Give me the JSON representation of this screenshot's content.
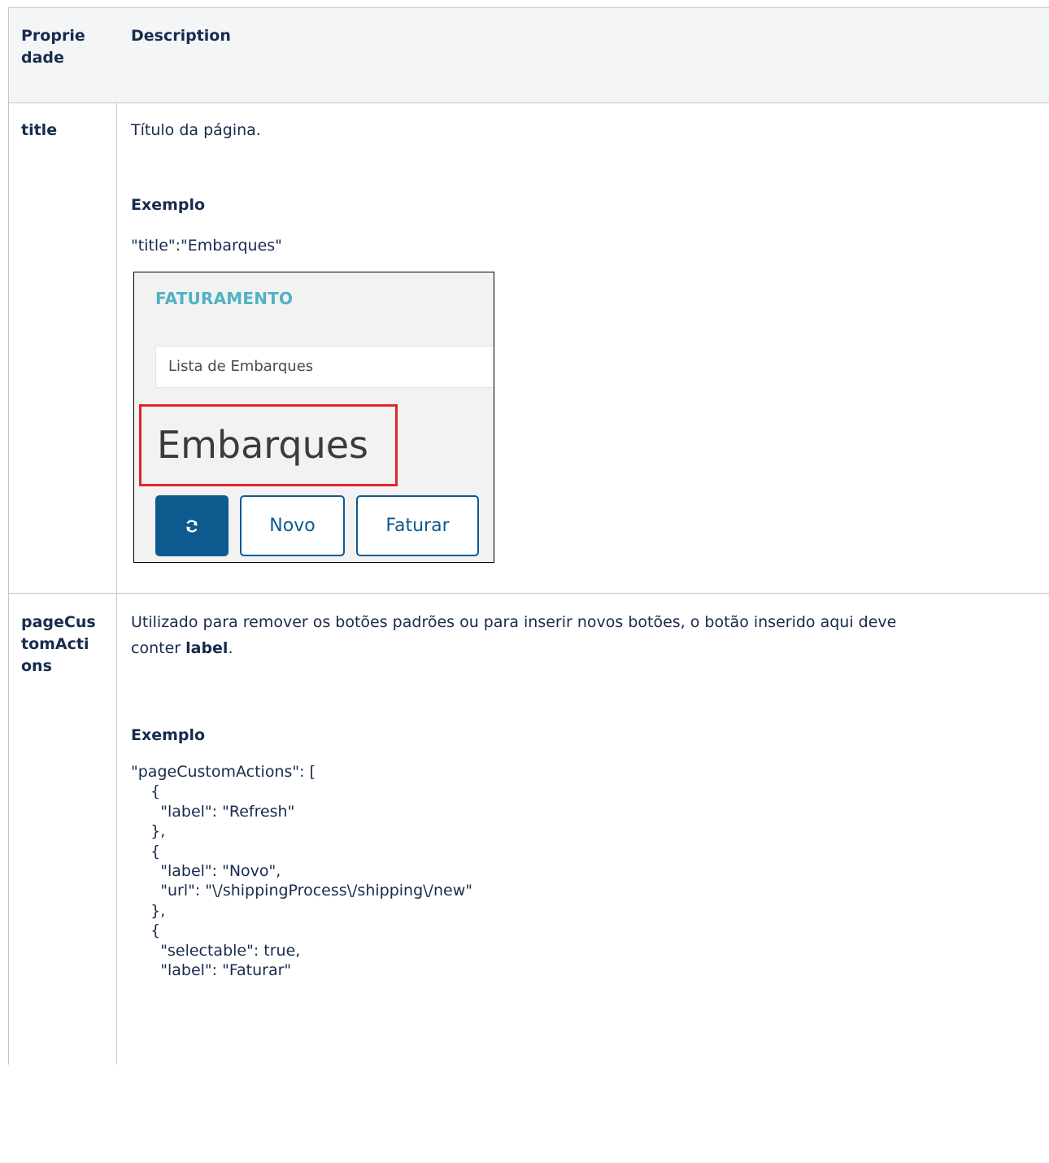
{
  "table": {
    "headers": {
      "property": "Proprie\ndade",
      "description": "Description"
    },
    "rows": [
      {
        "property": "title",
        "description": "Título da página.",
        "example_heading": "Exemplo",
        "example_code": "\"title\":\"Embarques\"",
        "screenshot": {
          "section_title": "FATURAMENTO",
          "breadcrumb": "Lista de Embarques",
          "page_title": "Embarques",
          "buttons": {
            "refresh_icon": "refresh-icon",
            "novo": "Novo",
            "faturar": "Faturar"
          },
          "colors": {
            "title": "#4fb3c1",
            "primary": "#0d5a8f",
            "highlight": "#e0242c"
          }
        }
      },
      {
        "property": "pageCus\ntomActi\nons",
        "description_part1": "Utilizado para remover os botões padrões ou para inserir novos botões, o botão inserido aqui deve",
        "description_part2_prefix": "conter ",
        "description_part2_bold": "label",
        "description_part2_suffix": ".",
        "example_heading": "Exemplo",
        "code_lines": [
          "\"pageCustomActions\": [",
          "    {",
          "      \"label\": \"Refresh\"",
          "    },",
          "    {",
          "      \"label\": \"Novo\",",
          "      \"url\": \"\\/shippingProcess\\/shipping\\/new\"",
          "    },",
          "    {",
          "      \"selectable\": true,",
          "      \"label\": \"Faturar\""
        ]
      }
    ]
  }
}
